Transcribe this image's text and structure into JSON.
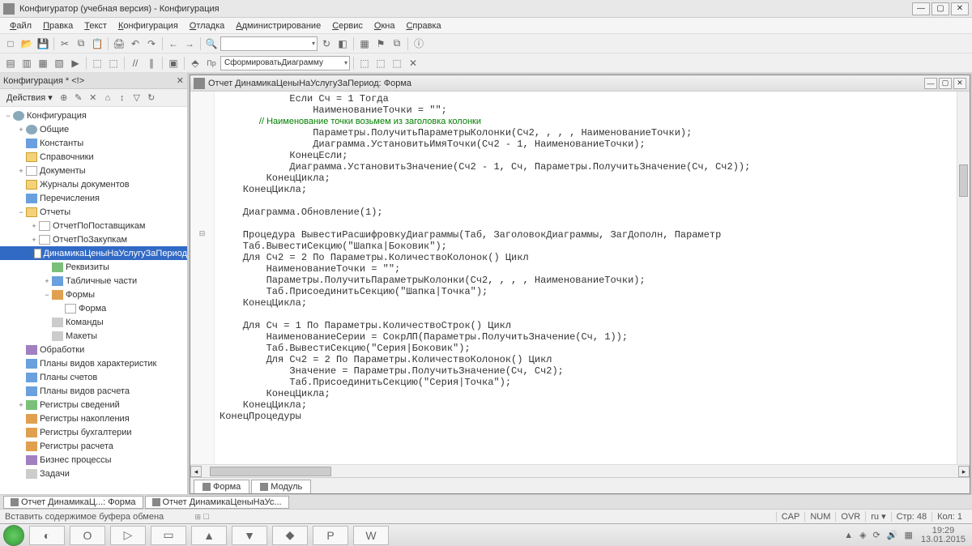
{
  "titlebar": {
    "title": "Конфигуратор (учебная версия) - Конфигурация"
  },
  "menu": [
    "Файл",
    "Правка",
    "Текст",
    "Конфигурация",
    "Отладка",
    "Администрирование",
    "Сервис",
    "Окна",
    "Справка"
  ],
  "toolbar2_combo": "СформироватьДиаграмму",
  "side": {
    "title": "Конфигурация *  <!>",
    "actions": "Действия ▾"
  },
  "tree": [
    {
      "d": 0,
      "exp": "−",
      "icon": "ic-gear",
      "label": "Конфигурация"
    },
    {
      "d": 1,
      "exp": "+",
      "icon": "ic-gear",
      "label": "Общие"
    },
    {
      "d": 1,
      "exp": "",
      "icon": "ic-blue",
      "label": "Константы"
    },
    {
      "d": 1,
      "exp": "",
      "icon": "ic-folder",
      "label": "Справочники"
    },
    {
      "d": 1,
      "exp": "+",
      "icon": "ic-doc",
      "label": "Документы"
    },
    {
      "d": 1,
      "exp": "",
      "icon": "ic-folder",
      "label": "Журналы документов"
    },
    {
      "d": 1,
      "exp": "",
      "icon": "ic-blue",
      "label": "Перечисления"
    },
    {
      "d": 1,
      "exp": "−",
      "icon": "ic-folder",
      "label": "Отчеты"
    },
    {
      "d": 2,
      "exp": "+",
      "icon": "ic-doc",
      "label": "ОтчетПоПоставщикам"
    },
    {
      "d": 2,
      "exp": "+",
      "icon": "ic-doc",
      "label": "ОтчетПоЗакупкам"
    },
    {
      "d": 2,
      "exp": "−",
      "icon": "ic-doc",
      "label": "ДинамикаЦеныНаУслугуЗаПериод",
      "sel": true
    },
    {
      "d": 3,
      "exp": "",
      "icon": "ic-green",
      "label": "Реквизиты"
    },
    {
      "d": 3,
      "exp": "+",
      "icon": "ic-blue",
      "label": "Табличные части"
    },
    {
      "d": 3,
      "exp": "−",
      "icon": "ic-orange",
      "label": "Формы"
    },
    {
      "d": 4,
      "exp": "",
      "icon": "ic-doc",
      "label": "Форма"
    },
    {
      "d": 3,
      "exp": "",
      "icon": "ic-gray",
      "label": "Команды"
    },
    {
      "d": 3,
      "exp": "",
      "icon": "ic-gray",
      "label": "Макеты"
    },
    {
      "d": 1,
      "exp": "",
      "icon": "ic-purple",
      "label": "Обработки"
    },
    {
      "d": 1,
      "exp": "",
      "icon": "ic-blue",
      "label": "Планы видов характеристик"
    },
    {
      "d": 1,
      "exp": "",
      "icon": "ic-blue",
      "label": "Планы счетов"
    },
    {
      "d": 1,
      "exp": "",
      "icon": "ic-blue",
      "label": "Планы видов расчета"
    },
    {
      "d": 1,
      "exp": "+",
      "icon": "ic-green",
      "label": "Регистры сведений"
    },
    {
      "d": 1,
      "exp": "",
      "icon": "ic-orange",
      "label": "Регистры накопления"
    },
    {
      "d": 1,
      "exp": "",
      "icon": "ic-orange",
      "label": "Регистры бухгалтерии"
    },
    {
      "d": 1,
      "exp": "",
      "icon": "ic-orange",
      "label": "Регистры расчета"
    },
    {
      "d": 1,
      "exp": "",
      "icon": "ic-purple",
      "label": "Бизнес процессы"
    },
    {
      "d": 1,
      "exp": "",
      "icon": "ic-gray",
      "label": "Задачи"
    }
  ],
  "doc": {
    "title": "Отчет ДинамикаЦеныНаУслугуЗаПериод: Форма",
    "tabs": [
      "Форма",
      "Модуль"
    ]
  },
  "code_lines": [
    "            Если Сч = 1 Тогда",
    "                НаименованиеТочки = \"\";",
    "                // Наименование точки возьмем из заголовка колонки",
    "                Параметры.ПолучитьПараметрыКолонки(Сч2, , , , НаименованиеТочки);",
    "                Диаграмма.УстановитьИмяТочки(Сч2 - 1, НаименованиеТочки);",
    "            КонецЕсли;",
    "            Диаграмма.УстановитьЗначение(Сч2 - 1, Сч, Параметры.ПолучитьЗначение(Сч, Сч2));",
    "        КонецЦикла;",
    "    КонецЦикла;",
    "",
    "    Диаграмма.Обновление(1);",
    "",
    "    Процедура ВывестиРасшифровкуДиаграммы(Таб, ЗаголовокДиаграммы, ЗагДополн, Параметр",
    "    Таб.ВывестиСекцию(\"Шапка|Боковик\");",
    "    Для Сч2 = 2 По Параметры.КоличествоКолонок() Цикл",
    "        НаименованиеТочки = \"\";",
    "        Параметры.ПолучитьПараметрыКолонки(Сч2, , , , НаименованиеТочки);",
    "        Таб.ПрисоединитьСекцию(\"Шапка|Точка\");",
    "    КонецЦикла;",
    "",
    "    Для Сч = 1 По Параметры.КоличествоСтрок() Цикл",
    "        НаименованиеСерии = СокрЛП(Параметры.ПолучитьЗначение(Сч, 1));",
    "        Таб.ВывестиСекцию(\"Серия|Боковик\");",
    "        Для Сч2 = 2 По Параметры.КоличествоКолонок() Цикл",
    "            Значение = Параметры.ПолучитьЗначение(Сч, Сч2);",
    "            Таб.ПрисоединитьСекцию(\"Серия|Точка\");",
    "        КонецЦикла;",
    "    КонецЦикла;",
    "КонецПроцедуры"
  ],
  "bottom_tabs": [
    "Отчет ДинамикаЦ...: Форма",
    "Отчет ДинамикаЦеныНаУс..."
  ],
  "status": {
    "hint": "Вставить содержимое буфера обмена",
    "cap": "CAP",
    "num": "NUM",
    "ovr": "OVR",
    "lang": "ru ▾",
    "line": "Стр: 48",
    "col": "Кол: 1"
  },
  "tray": {
    "time": "19:29",
    "date": "13.01.2015"
  }
}
